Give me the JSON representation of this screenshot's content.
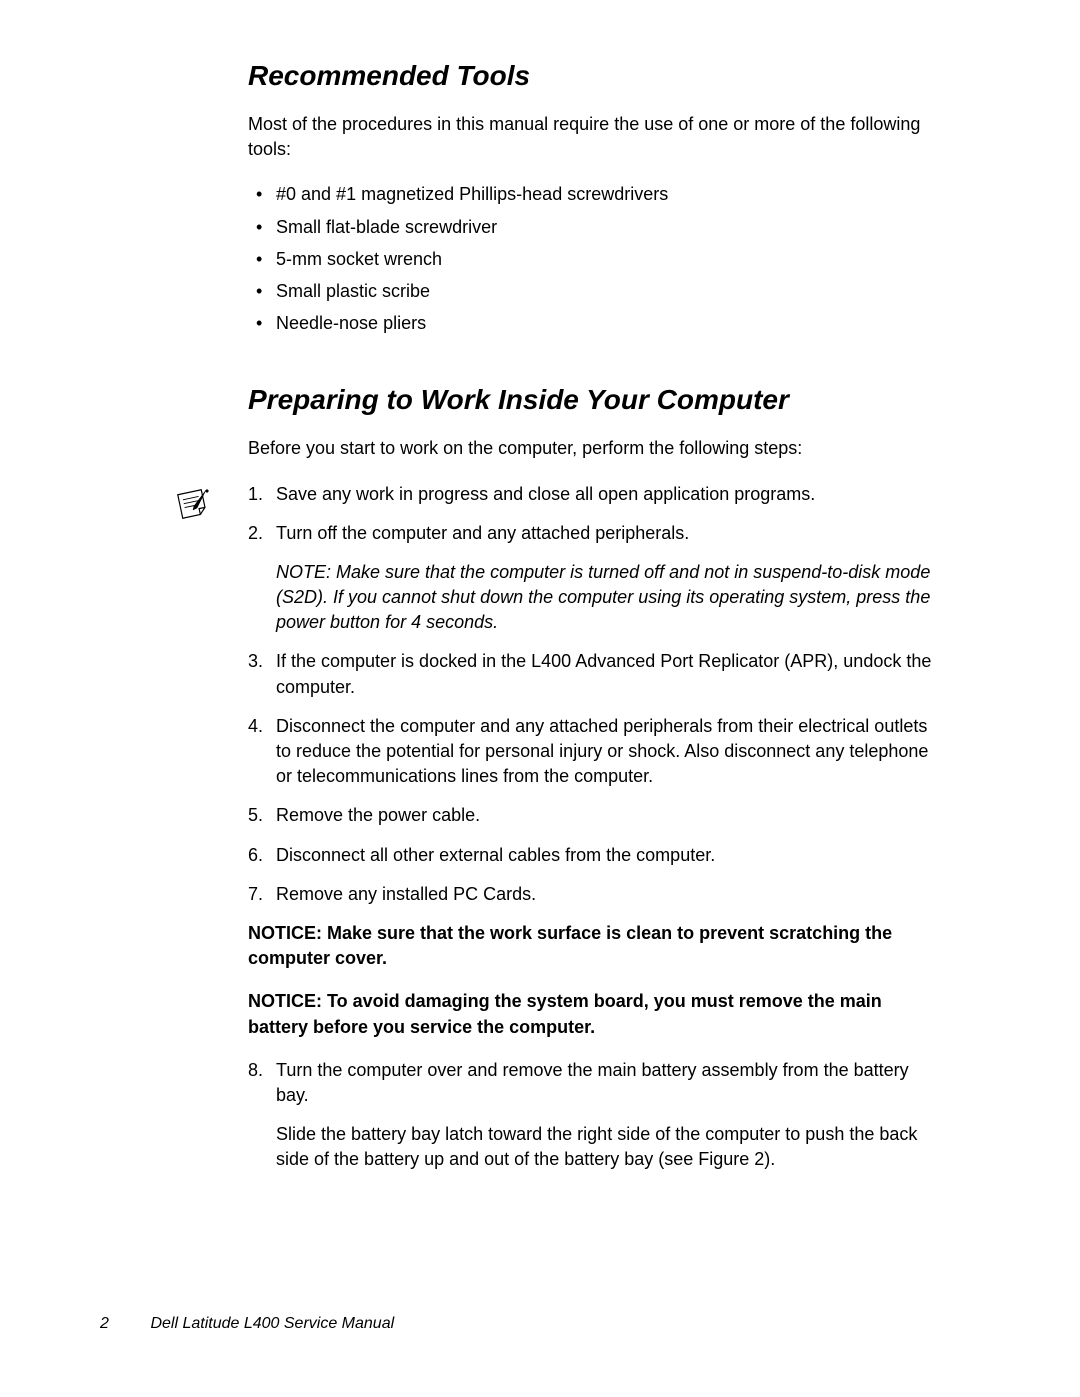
{
  "section1": {
    "heading": "Recommended Tools",
    "intro": "Most of the procedures in this manual require the use of one or more of the following tools:",
    "bullets": [
      "#0 and #1 magnetized Phillips-head screwdrivers",
      "Small flat-blade screwdriver",
      "5-mm socket wrench",
      "Small plastic scribe",
      "Needle-nose pliers"
    ]
  },
  "section2": {
    "heading": "Preparing to Work Inside Your Computer",
    "intro": "Before you start to work on the computer, perform the following steps:",
    "steps": {
      "1": "Save any work in progress and close all open application programs.",
      "2": "Turn off the computer and any attached peripherals.",
      "note_after_2": "NOTE: Make sure that the computer is turned off and not in suspend-to-disk mode (S2D). If you cannot shut down the computer using its operating system, press the power button for 4 seconds.",
      "3": "If the computer is docked in the L400 Advanced Port Replicator (APR), undock the computer.",
      "4": "Disconnect the computer and any attached peripherals from their electrical outlets to reduce the potential for personal injury or shock. Also disconnect any telephone or telecommunications lines from the computer.",
      "5": "Remove the power cable.",
      "6": "Disconnect all other external cables from the computer.",
      "7": "Remove any installed PC Cards.",
      "notice1": "NOTICE: Make sure that the work surface is clean to prevent scratching the computer cover.",
      "notice2": "NOTICE: To avoid damaging the system board, you must remove the main battery before you service the computer.",
      "8": "Turn the computer over and remove the main battery assembly from the battery bay.",
      "8_continuation": "Slide the battery bay latch toward the right side of the computer to push the back side of the battery up and out of the battery bay (see Figure 2)."
    }
  },
  "footer": {
    "page_number": "2",
    "manual_title": "Dell Latitude L400 Service Manual"
  }
}
